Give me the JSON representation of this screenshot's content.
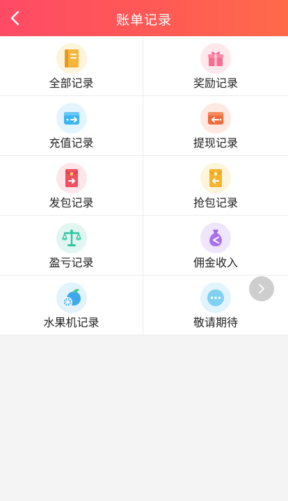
{
  "header": {
    "title": "账单记录"
  },
  "colors": {
    "header_start": "#ff4a65",
    "header_end": "#ff6a4a"
  },
  "items": [
    {
      "label": "全部记录",
      "icon": "book-icon"
    },
    {
      "label": "奖励记录",
      "icon": "gift-icon"
    },
    {
      "label": "充值记录",
      "icon": "wallet-in-icon"
    },
    {
      "label": "提现记录",
      "icon": "wallet-out-icon"
    },
    {
      "label": "发包记录",
      "icon": "red-envelope-send-icon"
    },
    {
      "label": "抢包记录",
      "icon": "red-envelope-grab-icon"
    },
    {
      "label": "盈亏记录",
      "icon": "balance-scale-icon"
    },
    {
      "label": "佣金收入",
      "icon": "money-bag-icon"
    },
    {
      "label": "水果机记录",
      "icon": "fruit-icon"
    },
    {
      "label": "敬请期待",
      "icon": "more-icon"
    }
  ]
}
